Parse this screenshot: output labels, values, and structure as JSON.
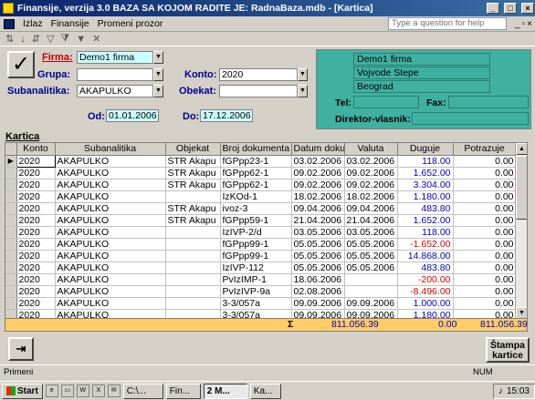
{
  "window": {
    "title": "Finansije, verzija 3.0      BAZA SA KOJOM RADITE JE: RadnaBaza.mdb - [Kartica]"
  },
  "menu": {
    "items": [
      "Izlaz",
      "Finansije",
      "Promeni prozor"
    ],
    "help_placeholder": "Type a question for help"
  },
  "form": {
    "firma_label": "Firma:",
    "firma_value": "Demo1 firma",
    "grupa_label": "Grupa:",
    "grupa_value": "",
    "konto_label": "Konto:",
    "konto_value": "2020",
    "subanalitika_label": "Subanalitika:",
    "subanalitika_value": "AKAPULKO",
    "obekat_label": "Obekat:",
    "obekat_value": "",
    "od_label": "Od:",
    "od_value": "01.01.2006",
    "do_label": "Do:",
    "do_value": "17.12.2006"
  },
  "company": {
    "name": "Demo1 firma",
    "street": "Vojvode Stepe",
    "city": "Beograd",
    "tel_label": "Tel:",
    "tel_value": "",
    "fax_label": "Fax:",
    "fax_value": "",
    "director_label": "Direktor-vlasnik:",
    "director_value": ""
  },
  "kartica": {
    "label": "Kartica",
    "columns": [
      "Konto",
      "Subanalitika",
      "Objekat",
      "Broj dokumenta",
      "Datum dokum",
      "Valuta",
      "Duguje",
      "Potrazuje"
    ],
    "rows": [
      [
        "2020",
        "AKAPULKO",
        "STR Akapu",
        "fGPpp23-1",
        "03.02.2006",
        "03.02.2006",
        "118.00",
        "0.00"
      ],
      [
        "2020",
        "AKAPULKO",
        "STR Akapu",
        "fGPpp62-1",
        "09.02.2006",
        "09.02.2006",
        "1.652.00",
        "0.00"
      ],
      [
        "2020",
        "AKAPULKO",
        "STR Akapu",
        "fGPpp62-1",
        "09.02.2006",
        "09.02.2006",
        "3.304.00",
        "0.00"
      ],
      [
        "2020",
        "AKAPULKO",
        "",
        "IzKOd-1",
        "18.02.2006",
        "18.02.2006",
        "1.180.00",
        "0.00"
      ],
      [
        "2020",
        "AKAPULKO",
        "STR Akapu",
        "ivoz-3",
        "09.04.2006",
        "09.04.2006",
        "483.80",
        "0.00"
      ],
      [
        "2020",
        "AKAPULKO",
        "STR Akapu",
        "fGPpp59-1",
        "21.04.2006",
        "21.04.2006",
        "1.652.00",
        "0.00"
      ],
      [
        "2020",
        "AKAPULKO",
        "",
        "IzIVP-2/d",
        "03.05.2006",
        "03.05.2006",
        "118.00",
        "0.00"
      ],
      [
        "2020",
        "AKAPULKO",
        "",
        "fGPpp99-1",
        "05.05.2006",
        "05.05.2006",
        "-1.652.00",
        "0.00"
      ],
      [
        "2020",
        "AKAPULKO",
        "",
        "fGPpp99-1",
        "05.05.2006",
        "05.05.2006",
        "14.868.00",
        "0.00"
      ],
      [
        "2020",
        "AKAPULKO",
        "",
        "IzIVP-112",
        "05.05.2006",
        "05.05.2006",
        "483.80",
        "0.00"
      ],
      [
        "2020",
        "AKAPULKO",
        "",
        "PvIzIMP-1",
        "18.06.2006",
        "",
        "-200.00",
        "0.00"
      ],
      [
        "2020",
        "AKAPULKO",
        "",
        "PvIzIVP-9a",
        "02.08.2006",
        "",
        "-8.496.00",
        "0.00"
      ],
      [
        "2020",
        "AKAPULKO",
        "",
        "3-3/057a",
        "09.09.2006",
        "09.09.2006",
        "1.000.00",
        "0.00"
      ],
      [
        "2020",
        "AKAPULKO",
        "",
        "3-3/057a",
        "09.09.2006",
        "09.09.2006",
        "1.180.00",
        "0.00"
      ]
    ],
    "sum_symbol": "Σ",
    "sum_col1": "811.056.39",
    "sum_col2": "0.00",
    "sum_col3": "811.056.39"
  },
  "buttons": {
    "stampa": "Štampa kartice"
  },
  "status": {
    "left": "Primeni",
    "num": "NUM"
  },
  "taskbar": {
    "start": "Start",
    "tasks": [
      "C:\\...",
      "Fin...",
      "2 M...",
      "Ka..."
    ],
    "clock": "15:03"
  },
  "colors": {
    "accent": "#40b0a0",
    "sum_row": "#ffcc66",
    "negative": "#e00000",
    "title_start": "#0a246a"
  }
}
